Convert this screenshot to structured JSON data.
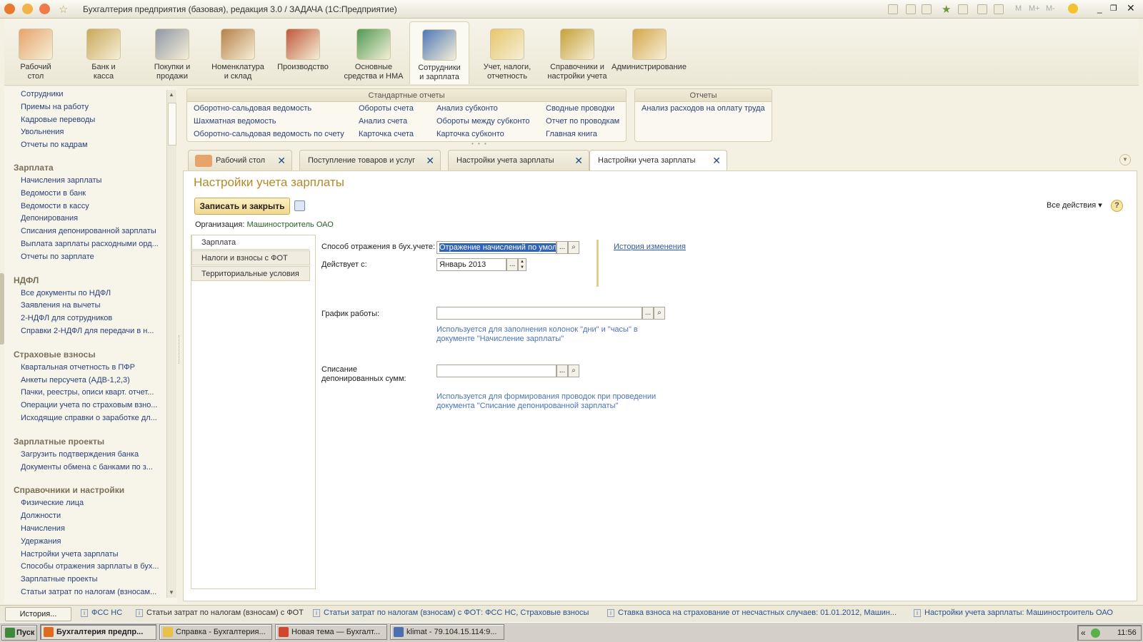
{
  "window": {
    "title": "Бухгалтерия предприятия (базовая), редакция 3.0 / ЗАДАЧА  (1С:Предприятие)",
    "title_icons": [
      "1c-logo-icon",
      "menu-icon",
      "back-icon",
      "favorite-star-icon"
    ],
    "right_controls": [
      "M",
      "M+",
      "M-"
    ]
  },
  "sections": [
    {
      "label1": "Рабочий",
      "label2": "стол",
      "icon": "desktop-icon",
      "color": "#e8a36b"
    },
    {
      "label1": "Банк и",
      "label2": "касса",
      "icon": "coins-icon",
      "color": "#c9a85a"
    },
    {
      "label1": "Покупки и",
      "label2": "продажи",
      "icon": "truck-icon",
      "color": "#8f97a8"
    },
    {
      "label1": "Номенклатура",
      "label2": "и склад",
      "icon": "warehouse-icon",
      "color": "#b8804a"
    },
    {
      "label1": "Производство",
      "label2": "",
      "icon": "tools-icon",
      "color": "#c0583b"
    },
    {
      "label1": "Основные",
      "label2": "средства и НМА",
      "icon": "assets-icon",
      "color": "#4f9a54"
    },
    {
      "label1": "Сотрудники",
      "label2": "и зарплата",
      "icon": "employee-icon",
      "color": "#4e78b7"
    },
    {
      "label1": "Учет, налоги,",
      "label2": "отчетность",
      "icon": "reports-icon",
      "color": "#e8c66a"
    },
    {
      "label1": "Справочники и",
      "label2": "настройки учета",
      "icon": "binders-icon",
      "color": "#c7a13a"
    },
    {
      "label1": "Администрирование",
      "label2": "",
      "icon": "admin-icon",
      "color": "#d6a64a"
    }
  ],
  "nav": {
    "items_top": [
      "Сотрудники",
      "Приемы на работу",
      "Кадровые переводы",
      "Увольнения",
      "Отчеты по кадрам"
    ],
    "groups": [
      {
        "title": "Зарплата",
        "items": [
          "Начисления зарплаты",
          "Ведомости в банк",
          "Ведомости в кассу",
          "Депонирования",
          "Списания депонированной зарплаты",
          "Выплата зарплаты расходными орд...",
          "Отчеты по зарплате"
        ]
      },
      {
        "title": "НДФЛ",
        "items": [
          "Все документы по НДФЛ",
          "Заявления на вычеты",
          "2-НДФЛ для сотрудников",
          "Справки 2-НДФЛ для передачи в н..."
        ]
      },
      {
        "title": "Страховые взносы",
        "items": [
          "Квартальная отчетность в ПФР",
          "Анкеты персучета (АДВ-1,2,3)",
          "Пачки, реестры, описи кварт. отчет...",
          "Операции учета по страховым взно...",
          "Исходящие справки о заработке дл..."
        ]
      },
      {
        "title": "Зарплатные проекты",
        "items": [
          "Загрузить подтверждения банка",
          "Документы обмена с банками по з..."
        ]
      },
      {
        "title": "Справочники и настройки",
        "items": [
          "Физические лица",
          "Должности",
          "Начисления",
          "Удержания",
          "Настройки учета зарплаты",
          "Способы отражения зарплаты в бух...",
          "Зарплатные проекты",
          "Статьи затрат по налогам (взносам..."
        ]
      }
    ]
  },
  "reports": {
    "standard_title": "Стандартные отчеты",
    "col1": [
      "Оборотно-сальдовая ведомость",
      "Шахматная ведомость",
      "Оборотно-сальдовая ведомость по счету"
    ],
    "col2": [
      "Обороты счета",
      "Анализ счета",
      "Карточка счета"
    ],
    "col3": [
      "Анализ субконто",
      "Обороты между субконто",
      "Карточка субконто"
    ],
    "col4": [
      "Сводные проводки",
      "Отчет по проводкам",
      "Главная книга"
    ],
    "other_title": "Отчеты",
    "other": [
      "Анализ расходов на оплату труда"
    ]
  },
  "tabs": [
    {
      "label": "Рабочий стол"
    },
    {
      "label": "Поступление товаров и услуг"
    },
    {
      "label": "Настройки учета зарплаты"
    },
    {
      "label": "Настройки учета зарплаты"
    }
  ],
  "form": {
    "title": "Настройки учета зарплаты",
    "save_close": "Записать и закрыть",
    "all_actions": "Все действия",
    "help": "?",
    "org_label": "Организация:",
    "org_value": "Машиностроитель ОАО",
    "vtabs": [
      "Зарплата",
      "Налоги и взносы с ФОТ",
      "Территориальные условия"
    ],
    "method_label": "Способ отражения в бух.учете:",
    "method_value": "Отражение начислений по умолч",
    "effective_label": "Действует с:",
    "effective_value": "Январь 2013",
    "history_link": "История изменения",
    "schedule_label": "График работы:",
    "schedule_value": "",
    "schedule_hint1": "Используется для заполнения колонок \"дни\" и \"часы\" в",
    "schedule_hint2": "документе \"Начисление зарплаты\"",
    "deposit_label1": "Списание",
    "deposit_label2": "депонированных сумм:",
    "deposit_value": "",
    "deposit_hint1": "Используется для формирования проводок при проведении",
    "deposit_hint2": "документа \"Списание депонированной зарплаты\"",
    "ellipsis": "...",
    "spin_up": "▲",
    "spin_down": "▼"
  },
  "statusbar": {
    "history_button": "История...",
    "items": [
      "ФСС НС",
      "Статьи затрат по налогам (взносам) с ФОТ",
      "Статьи затрат по налогам (взносам) с ФОТ: ФСС НС, Страховые взносы",
      "Ставка взноса на страхование от несчастных случаев: 01.01.2012, Машин...",
      "Настройки учета зарплаты: Машиностроитель ОАО"
    ]
  },
  "taskbar": {
    "start": "Пуск",
    "buttons": [
      {
        "label": "Бухгалтерия предпр...",
        "active": true,
        "color": "#e06a1e"
      },
      {
        "label": "Справка - Бухгалтерия...",
        "active": false,
        "color": "#e8c04a"
      },
      {
        "label": "Новая тема — Бухгалт...",
        "active": false,
        "color": "#d2452e"
      },
      {
        "label": "klimat - 79.104.15.114:9...",
        "active": false,
        "color": "#4a70b0"
      }
    ],
    "tray_arrows": "«",
    "time": "11:56"
  }
}
